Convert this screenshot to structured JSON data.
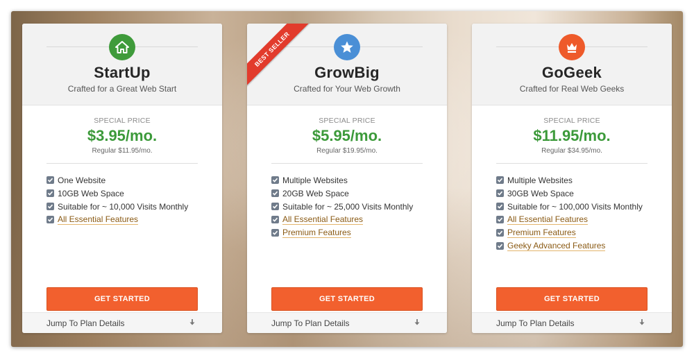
{
  "plans": [
    {
      "name": "StartUp",
      "tagline": "Crafted for a Great Web Start",
      "price_label": "SPECIAL PRICE",
      "price": "$3.95/mo.",
      "regular": "Regular $11.95/mo.",
      "icon": "house-icon",
      "icon_color": "#3f9b3b",
      "features": [
        {
          "label": "One Website",
          "link": false
        },
        {
          "label": "10GB Web Space",
          "link": false
        },
        {
          "label": "Suitable for ~ 10,000 Visits Monthly",
          "link": false
        },
        {
          "label": "All Essential Features",
          "link": true
        }
      ],
      "cta": "GET STARTED",
      "jump": "Jump To Plan Details"
    },
    {
      "name": "GrowBig",
      "tagline": "Crafted for Your Web Growth",
      "price_label": "SPECIAL PRICE",
      "price": "$5.95/mo.",
      "regular": "Regular $19.95/mo.",
      "icon": "star-icon",
      "icon_color": "#4a8fd6",
      "ribbon": "BEST SELLER",
      "features": [
        {
          "label": "Multiple Websites",
          "link": false
        },
        {
          "label": "20GB Web Space",
          "link": false
        },
        {
          "label": "Suitable for ~ 25,000 Visits Monthly",
          "link": false
        },
        {
          "label": "All Essential Features",
          "link": true
        },
        {
          "label": "Premium Features",
          "link": true
        }
      ],
      "cta": "GET STARTED",
      "jump": "Jump To Plan Details"
    },
    {
      "name": "GoGeek",
      "tagline": "Crafted for Real Web Geeks",
      "price_label": "SPECIAL PRICE",
      "price": "$11.95/mo.",
      "regular": "Regular $34.95/mo.",
      "icon": "crown-icon",
      "icon_color": "#ee5a2a",
      "features": [
        {
          "label": "Multiple Websites",
          "link": false
        },
        {
          "label": "30GB Web Space",
          "link": false
        },
        {
          "label": "Suitable for ~ 100,000 Visits Monthly",
          "link": false
        },
        {
          "label": "All Essential Features",
          "link": true
        },
        {
          "label": "Premium Features",
          "link": true
        },
        {
          "label": "Geeky Advanced Features",
          "link": true
        }
      ],
      "cta": "GET STARTED",
      "jump": "Jump To Plan Details"
    }
  ],
  "colors": {
    "price_green": "#3c9a3a",
    "cta_orange": "#f2602e",
    "ribbon_red": "#e23b2c"
  }
}
